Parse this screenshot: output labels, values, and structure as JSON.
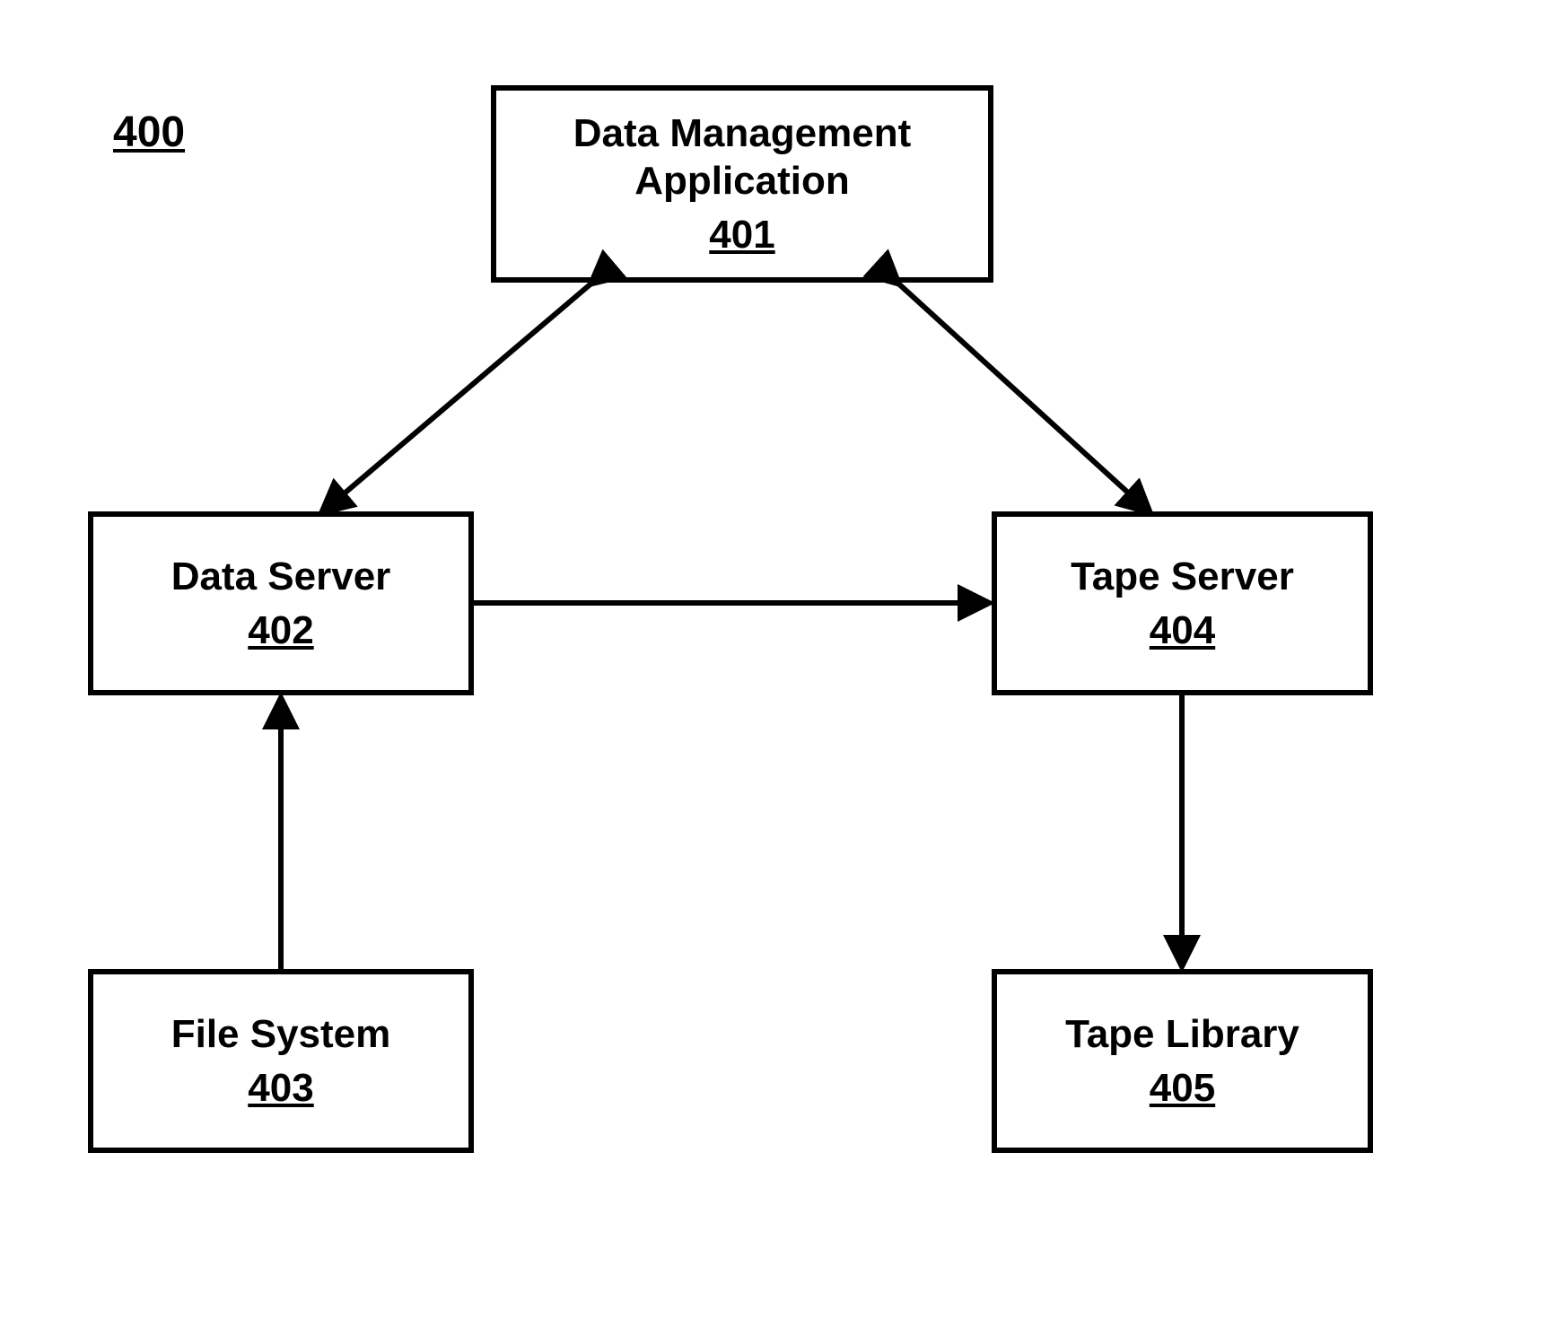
{
  "figure_label": "400",
  "boxes": {
    "data_management": {
      "title": "Data Management\nApplication",
      "number": "401"
    },
    "data_server": {
      "title": "Data Server",
      "number": "402"
    },
    "file_system": {
      "title": "File System",
      "number": "403"
    },
    "tape_server": {
      "title": "Tape Server",
      "number": "404"
    },
    "tape_library": {
      "title": "Tape Library",
      "number": "405"
    }
  }
}
